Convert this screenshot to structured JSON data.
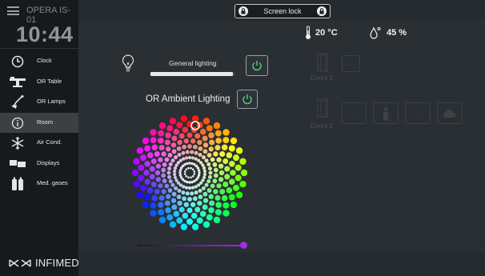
{
  "app": {
    "device_name": "OPERA IS-01",
    "time": "10:44",
    "brand": "INFIMED"
  },
  "header": {
    "lock_label": "Screen lock"
  },
  "status": {
    "temperature": "20 °C",
    "humidity": "45 %"
  },
  "sidebar": {
    "items": [
      {
        "label": "Clock",
        "icon": "clock-icon",
        "active": false
      },
      {
        "label": "OR Table",
        "icon": "or-table-icon",
        "active": false
      },
      {
        "label": "OR Lamps",
        "icon": "or-lamps-icon",
        "active": false
      },
      {
        "label": "Room",
        "icon": "info-icon",
        "active": true
      },
      {
        "label": "Air Cond.",
        "icon": "snowflake-icon",
        "active": false
      },
      {
        "label": "Displays",
        "icon": "displays-icon",
        "active": false
      },
      {
        "label": "Med. gases",
        "icon": "gas-cylinder-icon",
        "active": false
      }
    ]
  },
  "lighting": {
    "general_label": "General lighting",
    "general_level": 0.97,
    "ambient_label": "OR Ambient Lighting",
    "hue_level": 1.0,
    "accent": "#4fd27a"
  },
  "doors": {
    "door1_label": "Doors 1",
    "door2_label": "Doors 2"
  }
}
